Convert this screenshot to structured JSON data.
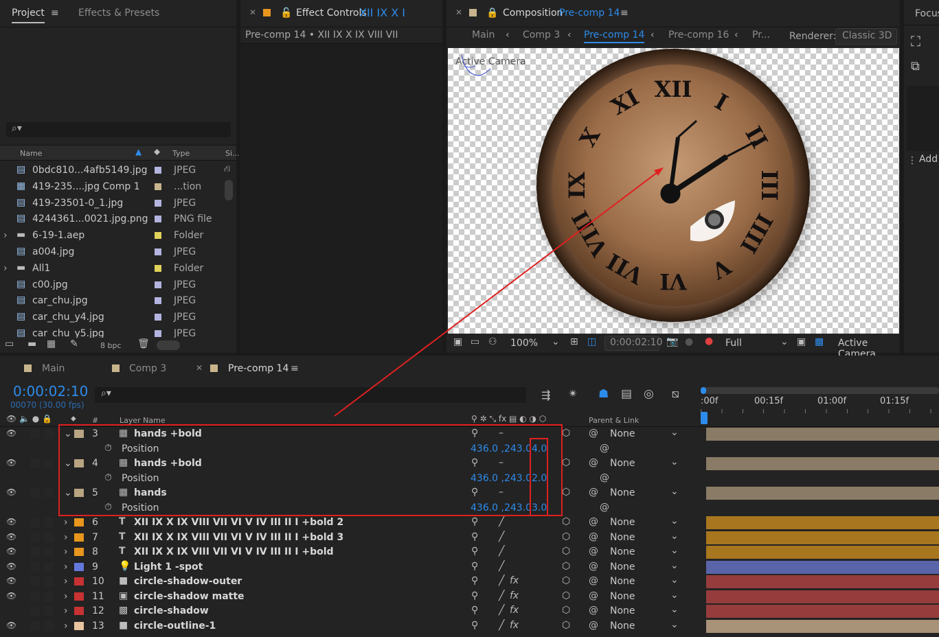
{
  "project_panel": {
    "tab_project": "Project",
    "tab_effects": "Effects & Presets",
    "columns": {
      "name": "Name",
      "type": "Type",
      "size": "Si..."
    },
    "items": [
      {
        "name": "0bdc810...4afb5149.jpg",
        "type": "JPEG",
        "swatch": "#b4b4e0",
        "kind": "image"
      },
      {
        "name": "419-235....jpg Comp 1",
        "type": "...tion",
        "swatch": "#c8b48c",
        "kind": "comp"
      },
      {
        "name": "419-23501-0_1.jpg",
        "type": "JPEG",
        "swatch": "#b4b4e0",
        "kind": "image"
      },
      {
        "name": "4244361...0021.jpg.png",
        "type": "PNG file",
        "swatch": "#b4b4e0",
        "kind": "image"
      },
      {
        "name": "6-19-1.aep",
        "type": "Folder",
        "swatch": "#e0d25a",
        "kind": "folder"
      },
      {
        "name": "a004.jpg",
        "type": "JPEG",
        "swatch": "#b4b4e0",
        "kind": "image"
      },
      {
        "name": "All1",
        "type": "Folder",
        "swatch": "#e0d25a",
        "kind": "folder"
      },
      {
        "name": "c00.jpg",
        "type": "JPEG",
        "swatch": "#b4b4e0",
        "kind": "image"
      },
      {
        "name": "car_chu.jpg",
        "type": "JPEG",
        "swatch": "#b4b4e0",
        "kind": "image"
      },
      {
        "name": "car_chu_y4.jpg",
        "type": "JPEG",
        "swatch": "#b4b4e0",
        "kind": "image"
      },
      {
        "name": "car_chu_y5.jpg",
        "type": "JPEG",
        "swatch": "#b4b4e0",
        "kind": "image"
      }
    ],
    "bpc": "8 bpc"
  },
  "effect_controls": {
    "title": "Effect Controls",
    "title_layer": "XII   IX   X   I",
    "subtitle": "Pre-comp 14 • XII    IX    X    IX    VIII    VII"
  },
  "composition": {
    "title": "Composition",
    "comp_name": "Pre-comp 14",
    "breadcrumbs": [
      "Main",
      "Comp 3",
      "Pre-comp 14",
      "Pre-comp 16",
      "Pr..."
    ],
    "renderer_label": "Renderer:",
    "renderer_value": "Classic 3D",
    "overlay_label": "Active Camera",
    "zoom": "100%",
    "timecode": "0:00:02:10",
    "resolution": "Full",
    "view": "Active Camera",
    "numerals": [
      "XII",
      "I",
      "II",
      "III",
      "IIII",
      "V",
      "VI",
      "VII",
      "VIII",
      "IX",
      "X",
      "XI"
    ]
  },
  "right_panel": {
    "tab": "Focus",
    "add": "Add"
  },
  "timeline": {
    "tabs": [
      "Main",
      "Comp 3",
      "Pre-comp 14"
    ],
    "timecode": "0:00:02:10",
    "frames": "00070 (30.00 fps)",
    "col_num": "#",
    "col_name": "Layer Name",
    "col_parent": "Parent & Link",
    "ruler": [
      ":00f",
      "00:15f",
      "01:00f",
      "01:15f"
    ],
    "layers": [
      {
        "num": "3",
        "name": "hands +bold",
        "color": "#b9a582",
        "icon": "comp",
        "expanded": true,
        "prop": "Position",
        "value": "436.0 ,243.0",
        "z": "4.0",
        "parent": "None",
        "bar": "#8a7b66"
      },
      {
        "num": "4",
        "name": "hands +bold",
        "color": "#b9a582",
        "icon": "comp",
        "expanded": true,
        "prop": "Position",
        "value": "436.0 ,243.0",
        "z": "2.0",
        "parent": "None",
        "bar": "#8a7b66"
      },
      {
        "num": "5",
        "name": "hands",
        "color": "#b9a582",
        "icon": "comp",
        "expanded": true,
        "prop": "Position",
        "value": "436.0 ,243.0",
        "z": "3.0",
        "parent": "None",
        "bar": "#8a7b66"
      },
      {
        "num": "6",
        "name": "XII    IX    X    IX    VIII    VII    VI    V    IV    III    II    I  +bold 2",
        "color": "#e8961e",
        "icon": "text",
        "parent": "None",
        "bar": "#a8761e"
      },
      {
        "num": "7",
        "name": "XII    IX    X    IX    VIII    VII    VI    V    IV    III    II    I  +bold 3",
        "color": "#e8961e",
        "icon": "text",
        "parent": "None",
        "bar": "#a8761e"
      },
      {
        "num": "8",
        "name": "XII    IX    X    IX    VIII    VII    VI    V    IV    III    II    I  +bold",
        "color": "#e8961e",
        "icon": "text",
        "parent": "None",
        "bar": "#a8761e"
      },
      {
        "num": "9",
        "name": "Light 1 -spot",
        "color": "#6478dc",
        "icon": "light",
        "parent": "None",
        "bar": "#5a64a8"
      },
      {
        "num": "10",
        "name": "circle-shadow-outer",
        "color": "#c83232",
        "icon": "solid",
        "parent": "None",
        "bar": "#963c3c"
      },
      {
        "num": "11",
        "name": "circle-shadow matte",
        "color": "#c83232",
        "icon": "matte",
        "parent": "None",
        "bar": "#963c3c"
      },
      {
        "num": "12",
        "name": "circle-shadow",
        "color": "#c83232",
        "icon": "matte2",
        "parent": "None",
        "bar": "#963c3c"
      },
      {
        "num": "13",
        "name": "circle-outline-1",
        "color": "#e8c4a0",
        "icon": "solid",
        "parent": "None",
        "bar": "#a89278"
      }
    ]
  },
  "colors": {
    "accent": "#2d8ceb",
    "highlight": "#e02020",
    "panel": "#232323"
  }
}
